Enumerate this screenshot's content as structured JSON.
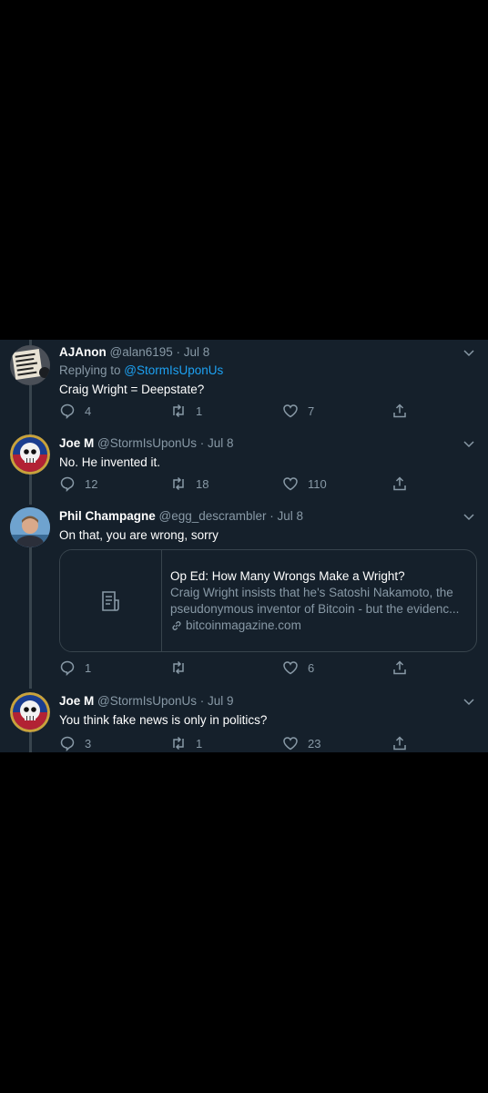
{
  "tweets": [
    {
      "name": "AJAnon",
      "handle": "@alan6195",
      "date": "Jul 8",
      "replying_prefix": "Replying to ",
      "replying_to": "@StormIsUponUs",
      "text": "Craig Wright = Deepstate?",
      "reply_count": "4",
      "retweet_count": "1",
      "like_count": "7",
      "avatar_icon": "protest-sign-avatar"
    },
    {
      "name": "Joe M",
      "handle": "@StormIsUponUs",
      "date": "Jul 8",
      "text": "No. He invented it.",
      "reply_count": "12",
      "retweet_count": "18",
      "like_count": "110",
      "avatar_icon": "skull-patriot-badge"
    },
    {
      "name": "Phil Champagne",
      "handle": "@egg_descrambler",
      "date": "Jul 8",
      "text": "On that, you are wrong, sorry",
      "reply_count": "1",
      "retweet_count": "",
      "like_count": "6",
      "avatar_icon": "person-photo",
      "card": {
        "title": "Op Ed: How Many Wrongs Make a Wright?",
        "description": "Craig Wright insists that he's Satoshi Nakamoto, the pseudonymous inventor of Bitcoin - but the evidenc...",
        "domain": "bitcoinmagazine.com",
        "thumb_icon": "document-icon"
      }
    },
    {
      "name": "Joe M",
      "handle": "@StormIsUponUs",
      "date": "Jul 9",
      "text": "You think fake news is only in politics?",
      "reply_count": "3",
      "retweet_count": "1",
      "like_count": "23",
      "avatar_icon": "skull-patriot-badge"
    }
  ],
  "separator": " · ",
  "colors": {
    "background": "#15202b",
    "outer": "#000000",
    "muted": "#8899a6",
    "accent": "#1da1f2",
    "thread_line": "#38444d"
  }
}
